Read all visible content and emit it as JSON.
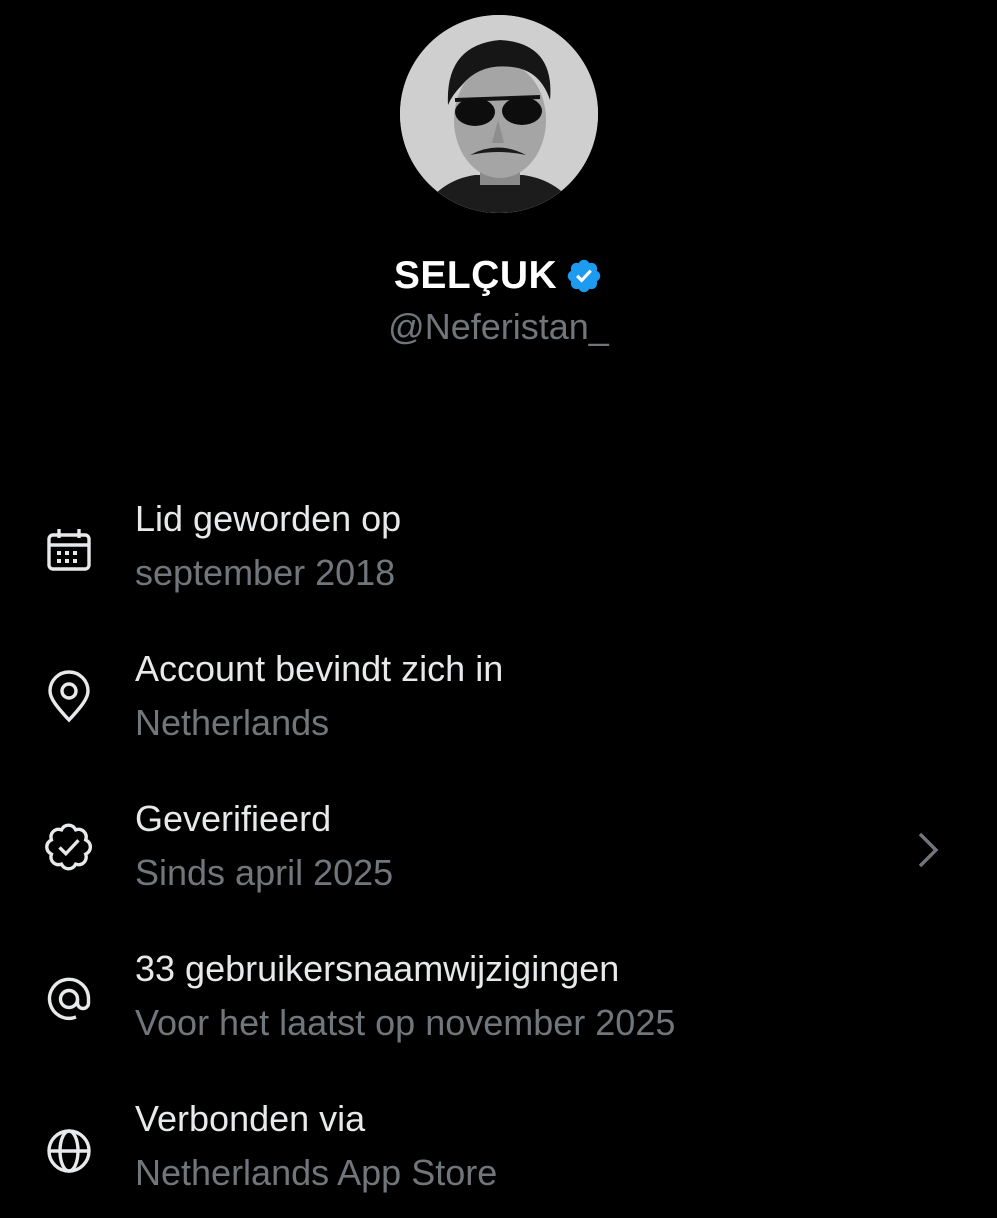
{
  "profile": {
    "display_name": "SELÇUK",
    "handle": "@Neferistan_",
    "verified": true,
    "badge_color": "#1d9bf0"
  },
  "about": {
    "items": [
      {
        "icon": "calendar-icon",
        "title": "Lid geworden op",
        "subtitle": "september 2018"
      },
      {
        "icon": "location-pin-icon",
        "title": "Account bevindt zich in",
        "subtitle": "Netherlands"
      },
      {
        "icon": "verified-outline-icon",
        "title": "Geverifieerd",
        "subtitle": "Sinds april 2025",
        "has_chevron": true
      },
      {
        "icon": "at-sign-icon",
        "title": "33 gebruikersnaamwijzigingen",
        "subtitle": "Voor het laatst op november 2025"
      },
      {
        "icon": "globe-icon",
        "title": "Verbonden via",
        "subtitle": "Netherlands App Store"
      }
    ]
  },
  "colors": {
    "background": "#000000",
    "primary_text": "#e7e9ea",
    "secondary_text": "#71767b",
    "accent": "#1d9bf0"
  }
}
